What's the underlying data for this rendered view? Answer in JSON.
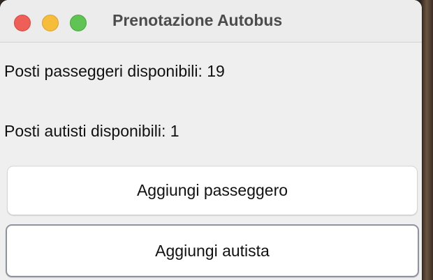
{
  "window": {
    "title": "Prenotazione Autobus"
  },
  "labels": {
    "passengers": "Posti passeggeri disponibili: 19",
    "drivers": "Posti autisti disponibili: 1"
  },
  "buttons": {
    "add_passenger": "Aggiungi passeggero",
    "add_driver": "Aggiungi autista"
  },
  "colors": {
    "close": "#ee5f57",
    "minimize": "#f6bd3b",
    "maximize": "#5fc454",
    "window_bg": "#efefef",
    "focus_border": "#8d94a0"
  }
}
